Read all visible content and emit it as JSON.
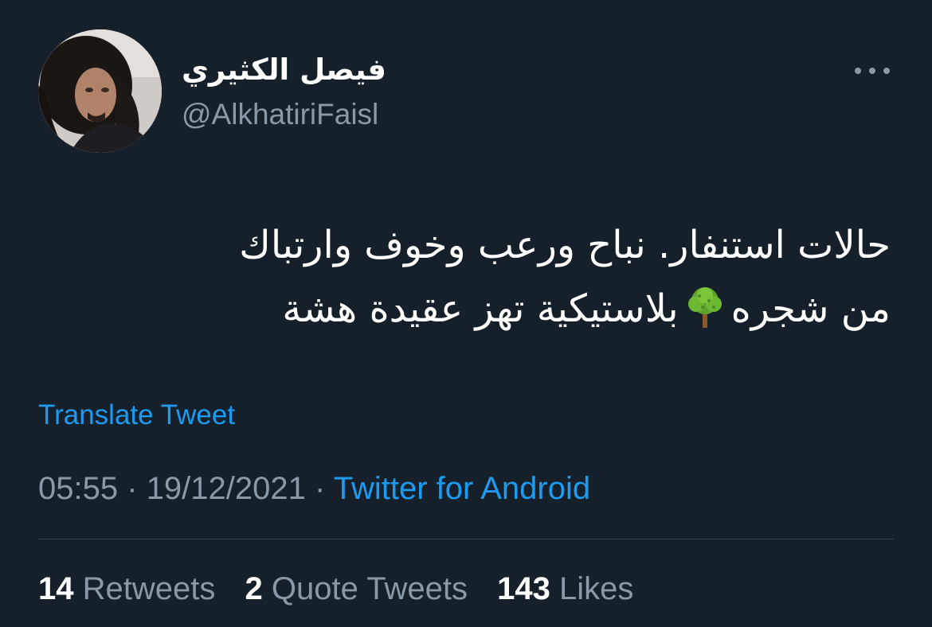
{
  "user": {
    "display_name": "فيصل الكثيري",
    "handle": "@AlkhatiriFaisl",
    "avatar_icon": "profile-photo"
  },
  "more_menu_icon": "more-horizontal-icon",
  "tweet": {
    "line1": "حالات استنفار. نباح ورعب وخوف وارتباك",
    "line2_before": "من شجره",
    "emoji": "deciduous-tree-emoji",
    "line2_after": "بلاستيكية تهز عقيدة هشة"
  },
  "translate_label": "Translate Tweet",
  "meta": {
    "time": "05:55",
    "separator": "·",
    "date": "19/12/2021",
    "source": "Twitter for Android"
  },
  "stats": {
    "retweets_count": "14",
    "retweets_label": "Retweets",
    "quotes_count": "2",
    "quotes_label": "Quote Tweets",
    "likes_count": "143",
    "likes_label": "Likes"
  },
  "colors": {
    "background": "#15202b",
    "accent": "#1d9bf0",
    "secondary_text": "#8b98a5",
    "divider": "#38444d"
  }
}
